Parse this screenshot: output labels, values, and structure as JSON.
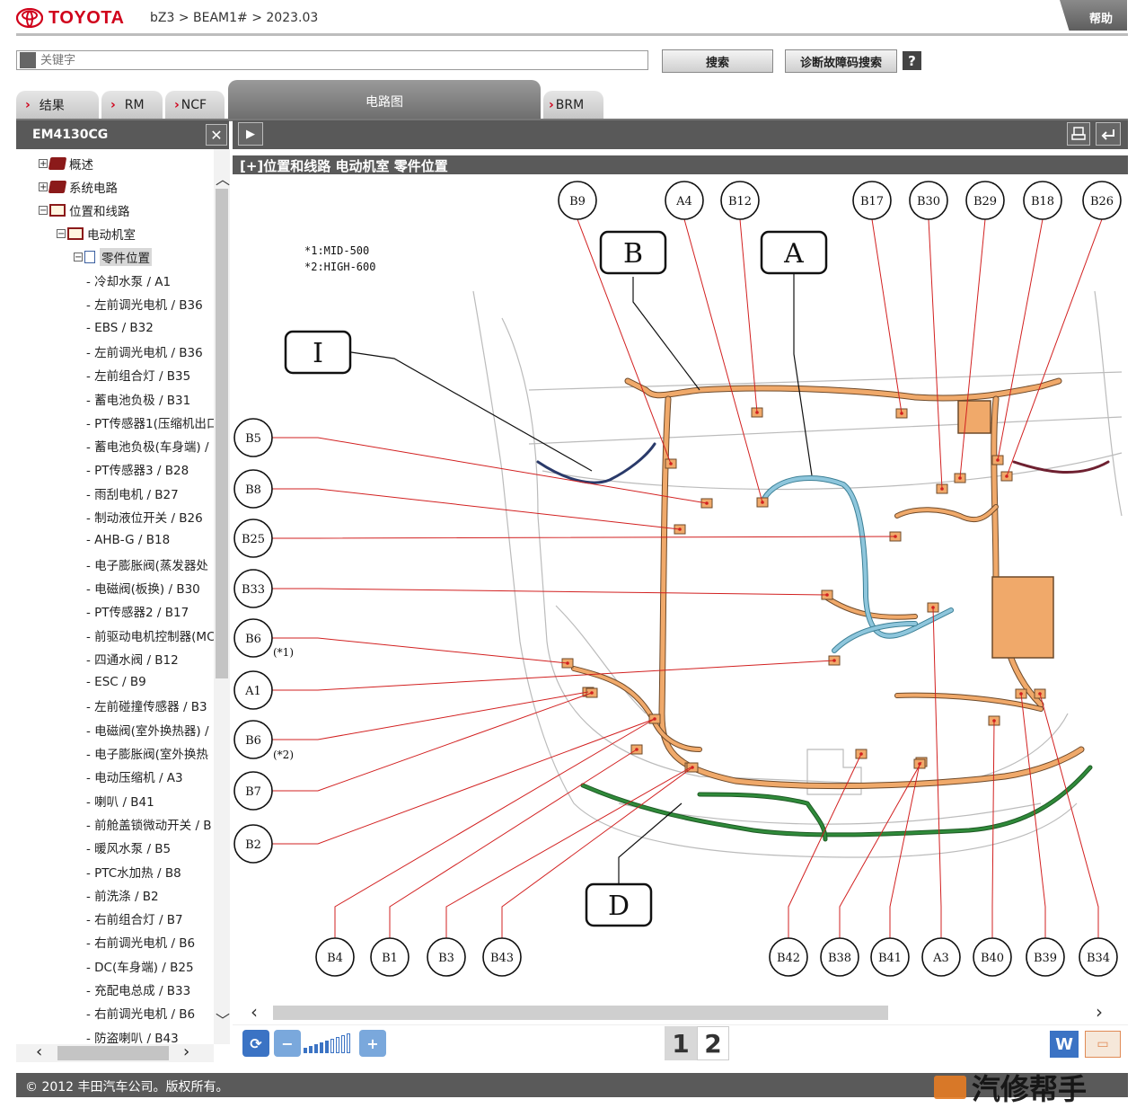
{
  "header": {
    "brand": "TOYOTA",
    "breadcrumb": "bZ3 > BEAM1# > 2023.03",
    "help_label": "帮助"
  },
  "search": {
    "placeholder": "关键字",
    "search_button": "搜索",
    "diag_button": "诊断故障码搜索",
    "help_button": "?"
  },
  "tabs": [
    {
      "label": "结果"
    },
    {
      "label": "RM"
    },
    {
      "label": "NCF"
    },
    {
      "label": "电路图",
      "active": true
    },
    {
      "label": "BRM"
    }
  ],
  "left_panel": {
    "title": "EM4130CG",
    "tree": [
      {
        "label": "概述",
        "kind": "book",
        "expander": "+"
      },
      {
        "label": "系统电路",
        "kind": "book",
        "expander": "+"
      },
      {
        "label": "位置和线路",
        "kind": "book-open",
        "expander": "-"
      },
      {
        "label": "电动机室",
        "kind": "book-open",
        "expander": "-"
      },
      {
        "label": "零件位置",
        "kind": "doc",
        "expander": "-",
        "selected": true
      }
    ],
    "items": [
      "- 冷却水泵 / A1",
      "- 左前调光电机 / B36",
      "- EBS / B32",
      "- 左前调光电机 / B36",
      "- 左前组合灯 / B35",
      "- 蓄电池负极 / B31",
      "- PT传感器1(压缩机出口",
      "- 蓄电池负极(车身端) /",
      "- PT传感器3 / B28",
      "- 雨刮电机 / B27",
      "- 制动液位开关 / B26",
      "- AHB-G / B18",
      "- 电子膨胀阀(蒸发器处",
      "- 电磁阀(板换) / B30",
      "- PT传感器2 / B17",
      "- 前驱动电机控制器(MC",
      "- 四通水阀 / B12",
      "- ESC / B9",
      "- 左前碰撞传感器 / B3",
      "- 电磁阀(室外换热器) /",
      "- 电子膨胀阀(室外换热",
      "- 电动压缩机 / A3",
      "- 喇叭 / B41",
      "- 前舱盖锁微动开关 / B",
      "- 暖风水泵 / B5",
      "- PTC水加热 / B8",
      "- 前洗涤 / B2",
      "- 右前组合灯 / B7",
      "- 右前调光电机 / B6",
      "- DC(车身端) / B25",
      "- 充配电总成 / B33",
      "- 右前调光电机 / B6",
      "- 防盗喇叭 / B43"
    ]
  },
  "right_panel": {
    "title": "[+]位置和线路  电动机室  零件位置",
    "notes": [
      "*1:MID-500",
      "*2:HIGH-600"
    ],
    "callouts_top": [
      "B9",
      "A4",
      "B12",
      "B17",
      "B30",
      "B29",
      "B18",
      "B26"
    ],
    "callouts_left": [
      "B5",
      "B8",
      "B25",
      "B33",
      "B6",
      "A1",
      "B6",
      "B7",
      "B2"
    ],
    "callouts_left_notes": [
      "(*1)",
      "(*2)"
    ],
    "callouts_bottom": [
      "B4",
      "B1",
      "B3",
      "B43",
      "B42",
      "B38",
      "B41",
      "A3",
      "B40",
      "B39",
      "B34"
    ],
    "area_labels": [
      "B",
      "A",
      "I",
      "D"
    ],
    "pages": [
      "1",
      "2"
    ],
    "zoom_level": 0.45,
    "word_label": "W"
  },
  "footer": {
    "copyright": "© 2012 丰田汽车公司。版权所有。",
    "watermark": "汽修帮手"
  },
  "colors": {
    "brand_red": "#d0021b",
    "harness_orange": "#f0a96a",
    "harness_blue": "#8ec6dc",
    "harness_green": "#2f8a3a",
    "leader_red": "#d22020"
  }
}
